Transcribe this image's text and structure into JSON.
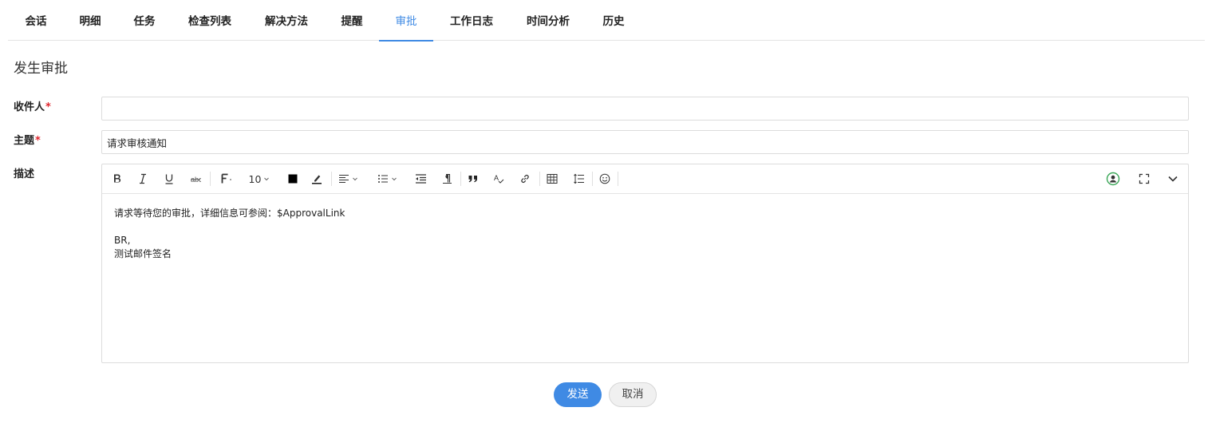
{
  "tabs": [
    {
      "label": "会话"
    },
    {
      "label": "明细"
    },
    {
      "label": "任务"
    },
    {
      "label": "检查列表"
    },
    {
      "label": "解决方法"
    },
    {
      "label": "提醒"
    },
    {
      "label": "审批"
    },
    {
      "label": "工作日志"
    },
    {
      "label": "时间分析"
    },
    {
      "label": "历史"
    }
  ],
  "active_tab": "审批",
  "form": {
    "title": "发生审批",
    "recipient": {
      "label": "收件人",
      "required_mark": "*",
      "value": ""
    },
    "subject": {
      "label": "主题",
      "required_mark": "*",
      "value": "请求审核通知"
    },
    "description": {
      "label": "描述"
    }
  },
  "toolbar": {
    "font_size": "10",
    "text_color": "#000000",
    "icons": [
      "bold-icon",
      "italic-icon",
      "underline-icon",
      "strikethrough-icon",
      "font-family-icon",
      "font-size-select",
      "text-color-icon",
      "highlight-icon",
      "align-icon",
      "list-icon",
      "outdent-icon",
      "paragraph-icon",
      "quote-icon",
      "clear-format-icon",
      "link-icon",
      "table-icon",
      "line-height-icon",
      "emoji-icon",
      "user-avatar-icon",
      "fullscreen-icon",
      "collapse-icon"
    ]
  },
  "editor": {
    "line1": "请求等待您的审批，详细信息可参阅：$ApprovalLink",
    "line2": "BR,",
    "line3": "测试邮件签名"
  },
  "buttons": {
    "send": "发送",
    "cancel": "取消"
  },
  "colors": {
    "accent": "#3f8ae4",
    "required": "#e0262e",
    "border": "#dcdcdc"
  }
}
